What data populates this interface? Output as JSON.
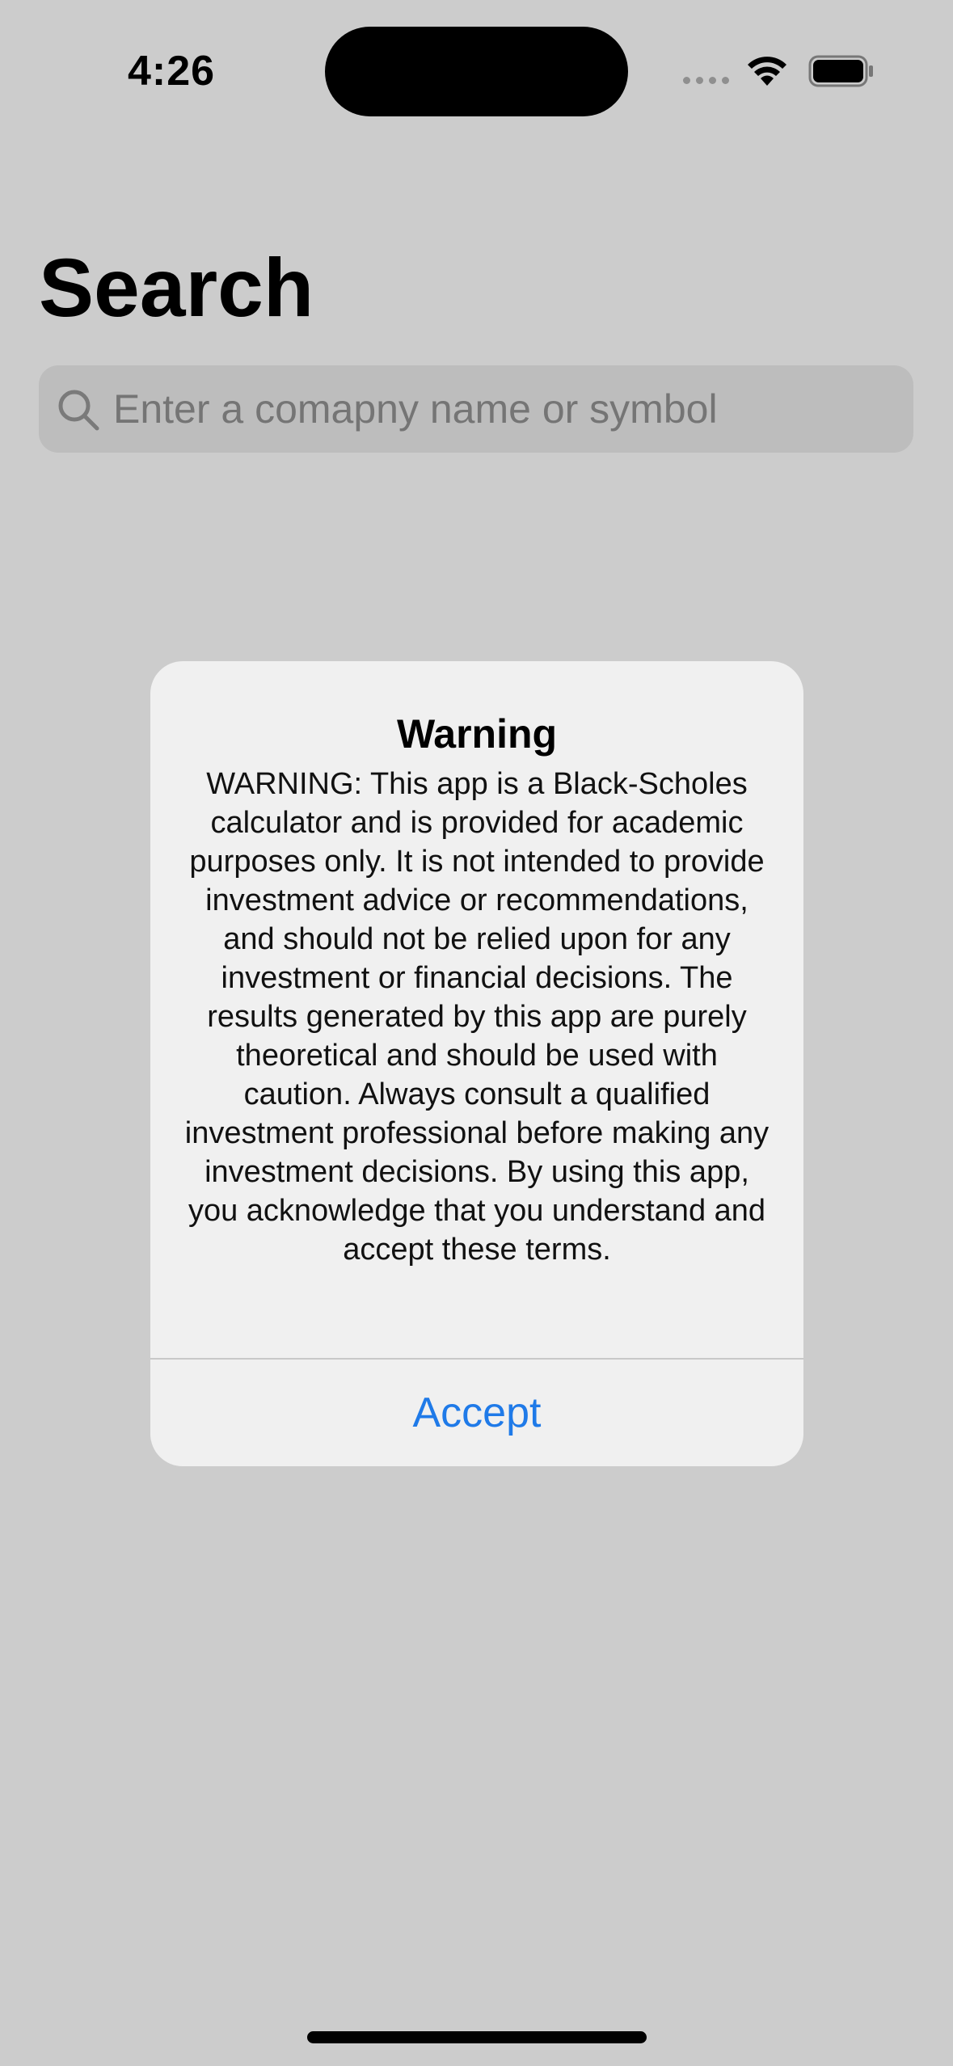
{
  "status_bar": {
    "time": "4:26"
  },
  "page": {
    "title": "Search"
  },
  "search": {
    "placeholder": "Enter a comapny name or symbol",
    "value": ""
  },
  "alert": {
    "title": "Warning",
    "message": "WARNING: This app is a Black-Scholes calculator and is provided for academic purposes only. It is not intended to provide investment advice or recommendations, and should not be relied upon for any investment or financial decisions. The results generated by this app are purely theoretical and should be used with caution. Always consult a qualified investment professional before making any investment decisions. By using this app, you acknowledge that you understand and accept these terms.",
    "accept_label": "Accept"
  },
  "colors": {
    "background": "#cccccc",
    "alert_background": "#f0f0f0",
    "accent": "#1f7ae8",
    "search_background": "#bdbdbd"
  },
  "icons": {
    "status": [
      "wifi-icon",
      "battery-icon"
    ],
    "search": "search-icon"
  }
}
